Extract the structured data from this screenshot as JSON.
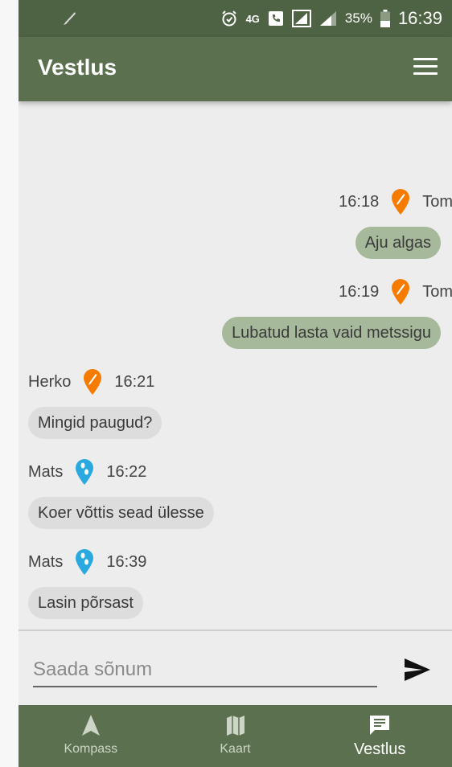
{
  "status_bar": {
    "battery": "35%",
    "time": "16:39",
    "network": "4G"
  },
  "app_bar": {
    "title": "Vestlus"
  },
  "messages": [
    {
      "sender": "Tom",
      "time": "16:18",
      "text": "Aju algas",
      "own": true,
      "pin_color": "#f57c00"
    },
    {
      "sender": "Tom",
      "time": "16:19",
      "text": "Lubatud lasta vaid metssigu",
      "own": true,
      "pin_color": "#f57c00"
    },
    {
      "sender": "Herko",
      "time": "16:21",
      "text": "Mingid paugud?",
      "own": false,
      "pin_color": "#f57c00"
    },
    {
      "sender": "Mats",
      "time": "16:22",
      "text": "Koer võttis sead ülesse",
      "own": false,
      "pin_color": "#29a9e0"
    },
    {
      "sender": "Mats",
      "time": "16:39",
      "text": "Lasin põrsast",
      "own": false,
      "pin_color": "#29a9e0"
    }
  ],
  "composer": {
    "placeholder": "Saada sõnum",
    "value": ""
  },
  "bottom_nav": [
    {
      "label": "Kompass",
      "icon": "navigation-arrow-icon",
      "active": false
    },
    {
      "label": "Kaart",
      "icon": "map-icon",
      "active": false
    },
    {
      "label": "Vestlus",
      "icon": "chat-icon",
      "active": true
    }
  ],
  "colors": {
    "primary": "#5b704f",
    "status_bar": "#4e6244",
    "own_bubble": "#a6b99a",
    "other_bubble": "#dddddd",
    "pin_orange": "#f57c00",
    "pin_blue": "#29a9e0"
  }
}
